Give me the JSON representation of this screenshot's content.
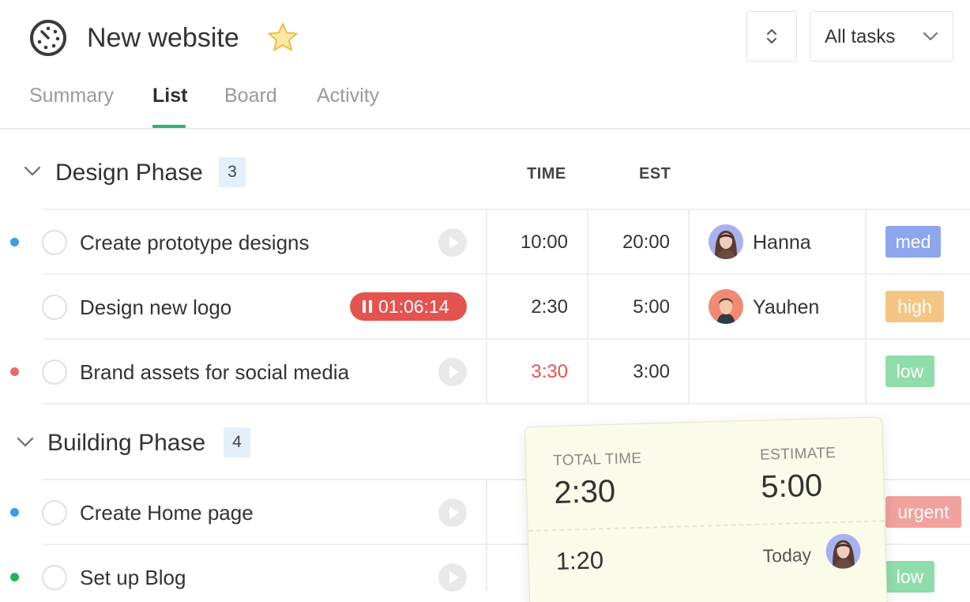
{
  "header": {
    "project_title": "New website",
    "filter_label": "All tasks"
  },
  "tabs": [
    {
      "label": "Summary",
      "active": false
    },
    {
      "label": "List",
      "active": true
    },
    {
      "label": "Board",
      "active": false
    },
    {
      "label": "Activity",
      "active": false
    }
  ],
  "columns": {
    "time": "TIME",
    "est": "EST"
  },
  "groups": [
    {
      "title": "Design Phase",
      "count": "3",
      "tasks": [
        {
          "name": "Create prototype designs",
          "dot_color": "#3a9ee6",
          "time": "10:00",
          "est": "20:00",
          "assignee": "Hanna",
          "tag": "med",
          "tag_color": "#8ea6ee"
        },
        {
          "name": "Design new logo",
          "running_timer": "01:06:14",
          "time": "2:30",
          "est": "5:00",
          "assignee": "Yauhen",
          "tag": "high",
          "tag_color": "#f5c584"
        },
        {
          "name": "Brand assets for social media",
          "dot_color": "#e56b67",
          "time": "3:30",
          "est": "3:00",
          "tag": "low",
          "tag_color": "#8fddaa"
        }
      ]
    },
    {
      "title": "Building Phase",
      "count": "4",
      "tasks": [
        {
          "name": "Create Home page",
          "dot_color": "#3a9ee6",
          "tag": "urgent",
          "tag_color": "#f1a29d"
        },
        {
          "name": "Set up Blog",
          "dot_color": "#22b35e",
          "tag": "low",
          "tag_color": "#8fddaa"
        }
      ]
    }
  ],
  "popover": {
    "total_label": "TOTAL TIME",
    "total_value": "2:30",
    "estimate_label": "ESTIMATE",
    "estimate_value": "5:00",
    "entry_time": "1:20",
    "entry_day": "Today"
  },
  "colors": {
    "accent_green": "#2bb673",
    "overtime_red": "#e5534f",
    "count_badge_bg": "#e3eff9"
  }
}
